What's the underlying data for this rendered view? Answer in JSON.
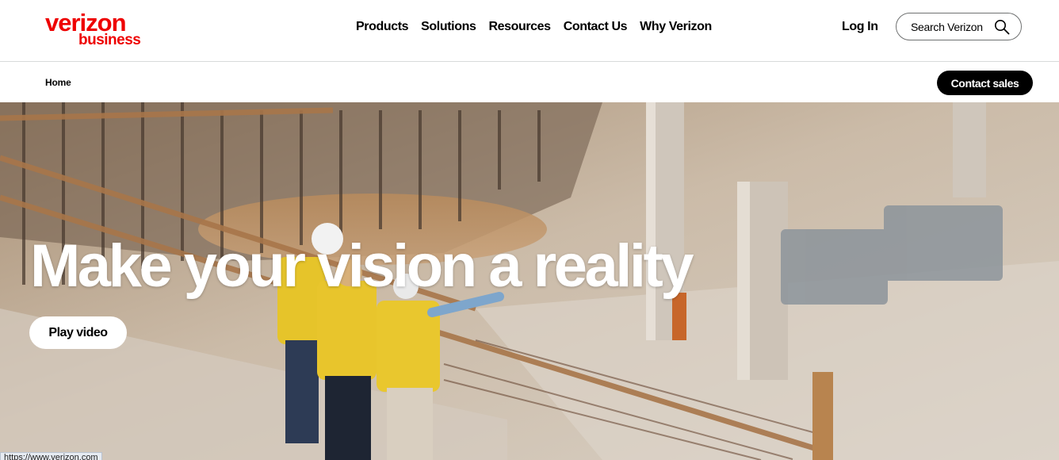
{
  "header": {
    "logo": {
      "line1": "verizon",
      "line2": "business"
    },
    "nav": [
      {
        "label": "Products"
      },
      {
        "label": "Solutions"
      },
      {
        "label": "Resources"
      },
      {
        "label": "Contact Us"
      },
      {
        "label": "Why Verizon"
      }
    ],
    "login_label": "Log In",
    "search": {
      "placeholder": "Search Verizon",
      "icon": "search-icon"
    }
  },
  "subbar": {
    "breadcrumb": "Home",
    "contact_sales_label": "Contact sales"
  },
  "hero": {
    "headline": "Make your vision a reality",
    "play_label": "Play video"
  },
  "status_bar": {
    "url": "https://www.verizon.com"
  },
  "colors": {
    "brand": "#ee0000",
    "button_dark": "#000000",
    "text": "#000000"
  }
}
